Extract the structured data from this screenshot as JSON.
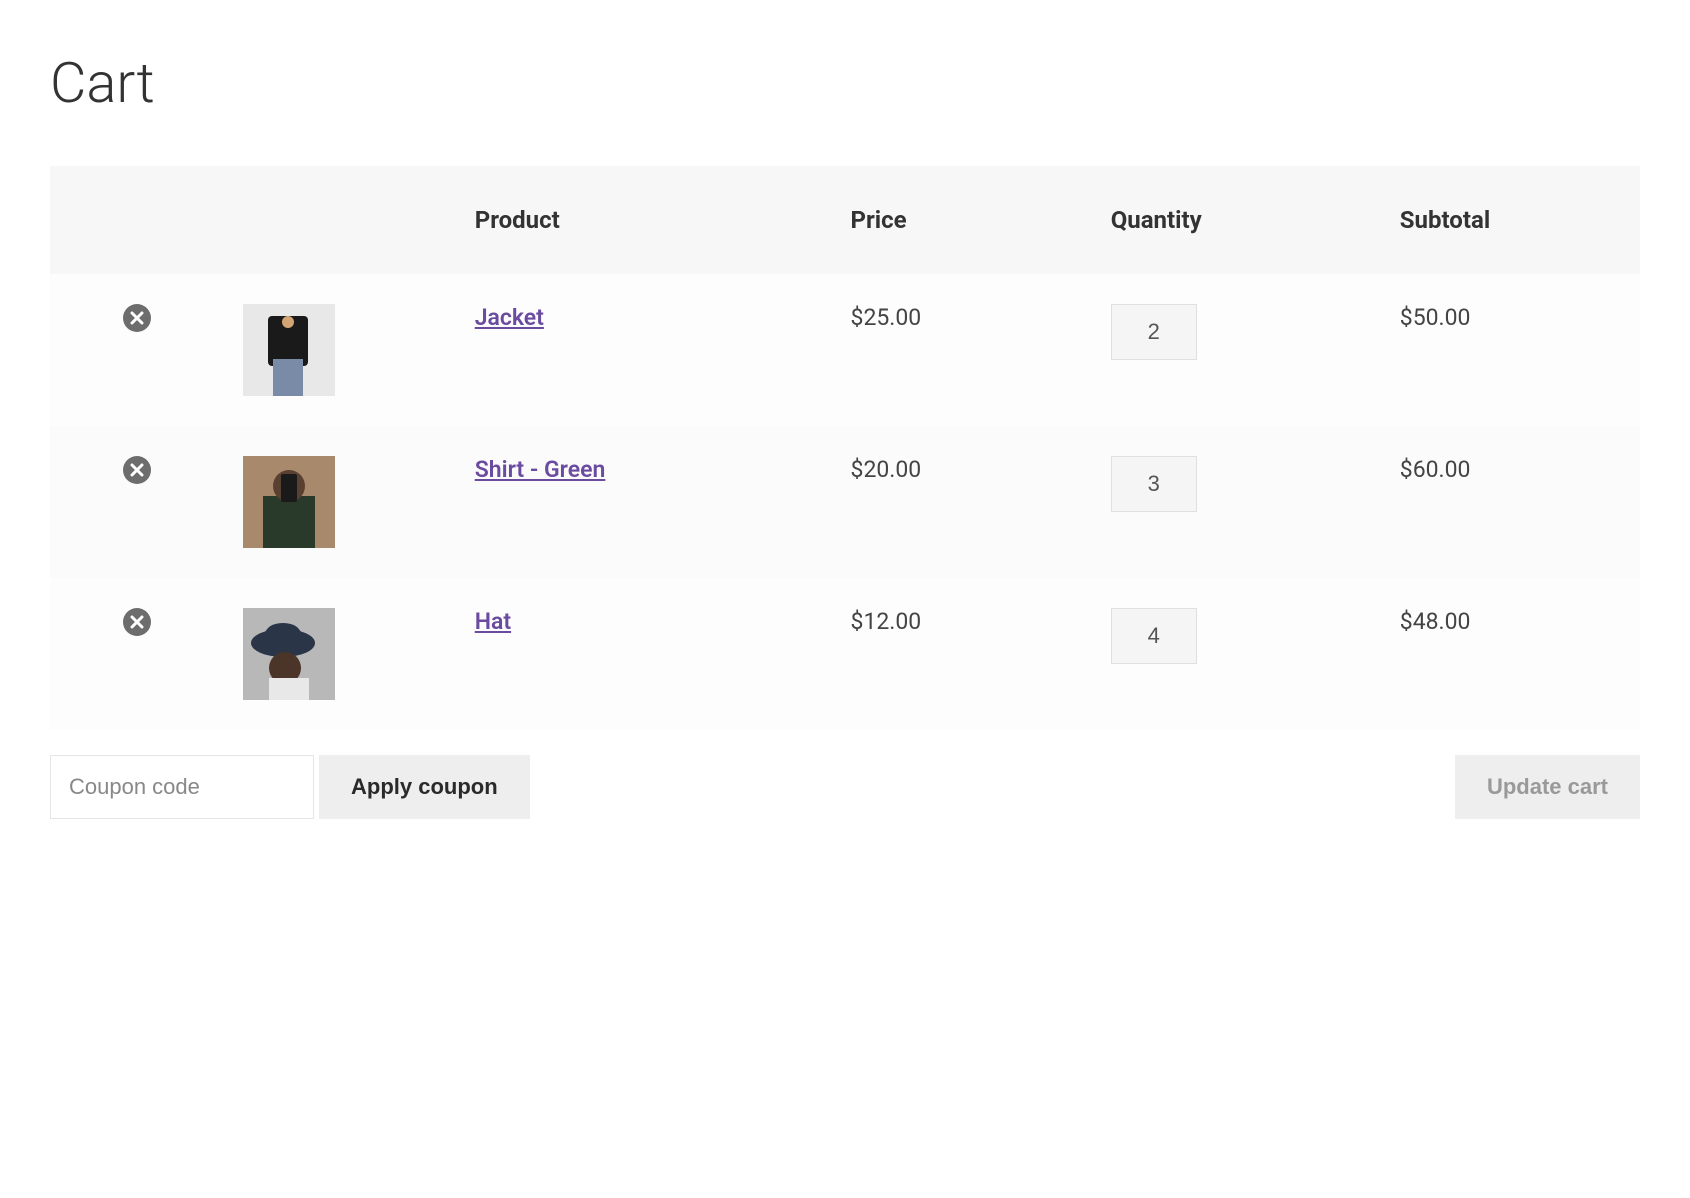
{
  "page": {
    "title": "Cart"
  },
  "table": {
    "headers": {
      "product": "Product",
      "price": "Price",
      "quantity": "Quantity",
      "subtotal": "Subtotal"
    }
  },
  "items": [
    {
      "name": "Jacket",
      "price": "$25.00",
      "quantity": "2",
      "subtotal": "$50.00"
    },
    {
      "name": "Shirt - Green",
      "price": "$20.00",
      "quantity": "3",
      "subtotal": "$60.00"
    },
    {
      "name": "Hat",
      "price": "$12.00",
      "quantity": "4",
      "subtotal": "$48.00"
    }
  ],
  "actions": {
    "coupon_placeholder": "Coupon code",
    "apply_coupon_label": "Apply coupon",
    "update_cart_label": "Update cart"
  }
}
